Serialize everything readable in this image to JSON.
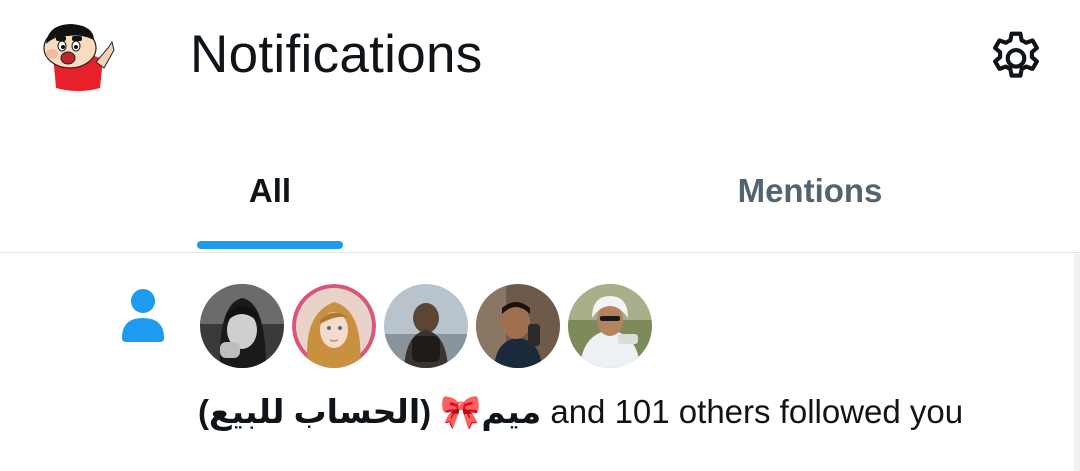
{
  "header": {
    "title": "Notifications",
    "profile_avatar_icon": "shin-chan-avatar-icon",
    "settings_icon": "gear-icon"
  },
  "tabs": [
    {
      "label": "All",
      "selected": true
    },
    {
      "label": "Mentions",
      "selected": false
    }
  ],
  "notification": {
    "type_icon": "person-follow-icon",
    "follower_avatar_count": 5,
    "display_name": "(الحساب للبيع) 🎀ميم",
    "text": " and 101 others followed you"
  },
  "colors": {
    "accent": "#1d9bf0",
    "text_primary": "#0f1419",
    "text_secondary": "#536471",
    "divider": "#e4e6e8"
  }
}
